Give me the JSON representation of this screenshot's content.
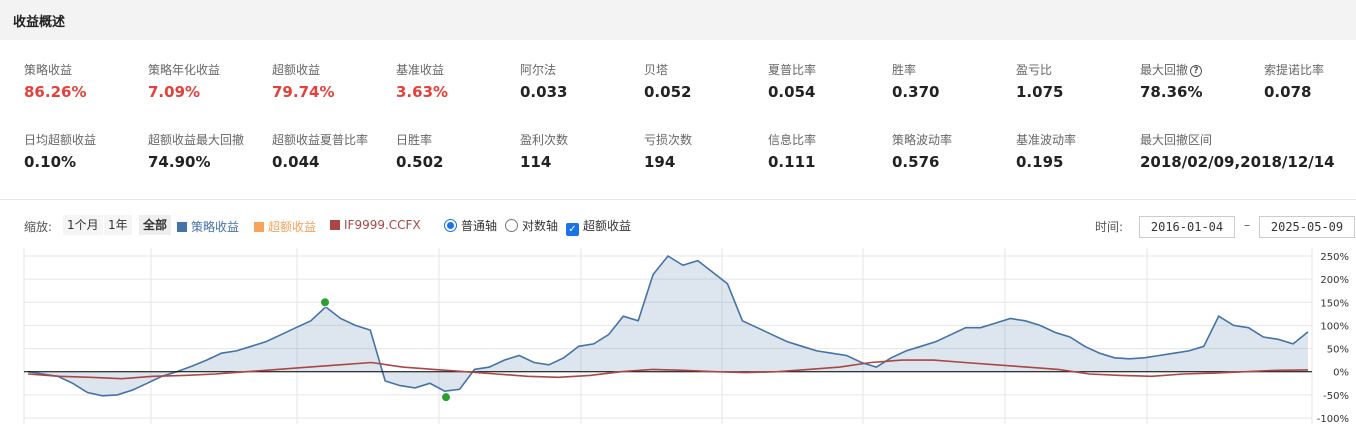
{
  "header": {
    "title": "收益概述"
  },
  "metrics_row1": [
    {
      "label": "策略收益",
      "value": "86.26%",
      "red": true
    },
    {
      "label": "策略年化收益",
      "value": "7.09%",
      "red": true
    },
    {
      "label": "超额收益",
      "value": "79.74%",
      "red": true
    },
    {
      "label": "基准收益",
      "value": "3.63%",
      "red": true
    },
    {
      "label": "阿尔法",
      "value": "0.033"
    },
    {
      "label": "贝塔",
      "value": "0.052"
    },
    {
      "label": "夏普比率",
      "value": "0.054"
    },
    {
      "label": "胜率",
      "value": "0.370"
    },
    {
      "label": "盈亏比",
      "value": "1.075"
    },
    {
      "label": "最大回撤",
      "value": "78.36%",
      "help": "?"
    },
    {
      "label": "索提诺比率",
      "value": "0.078"
    }
  ],
  "metrics_row2": [
    {
      "label": "日均超额收益",
      "value": "0.10%"
    },
    {
      "label": "超额收益最大回撤",
      "value": "74.90%"
    },
    {
      "label": "超额收益夏普比率",
      "value": "0.044"
    },
    {
      "label": "日胜率",
      "value": "0.502"
    },
    {
      "label": "盈利次数",
      "value": "114"
    },
    {
      "label": "亏损次数",
      "value": "194"
    },
    {
      "label": "信息比率",
      "value": "0.111"
    },
    {
      "label": "策略波动率",
      "value": "0.576"
    },
    {
      "label": "基准波动率",
      "value": "0.195"
    },
    {
      "label": "最大回撤区间",
      "value": "2018/02/09,2018/12/14"
    }
  ],
  "toolbar": {
    "zoom_label": "缩放:",
    "zoom_1m": "1个月",
    "zoom_1y": "1年",
    "zoom_all": "全部",
    "legend_strategy": "策略收益",
    "legend_excess": "超额收益",
    "legend_benchmark": "IF9999.CCFX",
    "opt_linear": "普通轴",
    "opt_log": "对数轴",
    "opt_excess": "超额收益",
    "time_label": "时间:",
    "date_from": "2016-01-04",
    "date_to": "2025-05-09",
    "dash": "–"
  },
  "colors": {
    "strategy": "#4572a7",
    "excess": "#f7a35c",
    "benchmark": "#aa4643",
    "positive": "#e5403a",
    "accent": "#1a73e8"
  },
  "chart_data": {
    "type": "line",
    "y_ticks": [
      "250%",
      "200%",
      "150%",
      "100%",
      "50%",
      "0%",
      "-50%",
      "-100%"
    ],
    "ylim": [
      -100,
      250
    ],
    "x_range": [
      "2016-01-04",
      "2025-05-09"
    ],
    "series": [
      {
        "name": "策略收益",
        "values": [
          0,
          -5,
          -10,
          -25,
          -45,
          -52,
          -50,
          -40,
          -25,
          -10,
          0,
          12,
          25,
          40,
          45,
          55,
          65,
          80,
          95,
          110,
          140,
          115,
          100,
          90,
          -20,
          -30,
          -35,
          -25,
          -42,
          -38,
          5,
          10,
          25,
          35,
          20,
          15,
          30,
          55,
          60,
          80,
          120,
          110,
          210,
          250,
          230,
          240,
          215,
          190,
          110,
          95,
          80,
          65,
          55,
          45,
          40,
          35,
          20,
          10,
          30,
          45,
          55,
          65,
          80,
          95,
          95,
          105,
          115,
          110,
          100,
          85,
          75,
          55,
          40,
          30,
          28,
          30,
          35,
          40,
          45,
          55,
          120,
          100,
          95,
          75,
          70,
          60,
          86
        ]
      },
      {
        "name": "IF9999.CCFX",
        "values": [
          -5,
          -10,
          -12,
          -15,
          -10,
          -8,
          -5,
          0,
          5,
          10,
          15,
          20,
          10,
          5,
          0,
          -5,
          -10,
          -12,
          -8,
          0,
          5,
          3,
          0,
          -2,
          0,
          5,
          10,
          20,
          25,
          25,
          20,
          15,
          10,
          5,
          -5,
          -8,
          -10,
          -5,
          -3,
          0,
          3,
          4
        ]
      }
    ],
    "markers": [
      {
        "label": "max",
        "value": 150
      },
      {
        "label": "min",
        "value": -55
      }
    ]
  }
}
